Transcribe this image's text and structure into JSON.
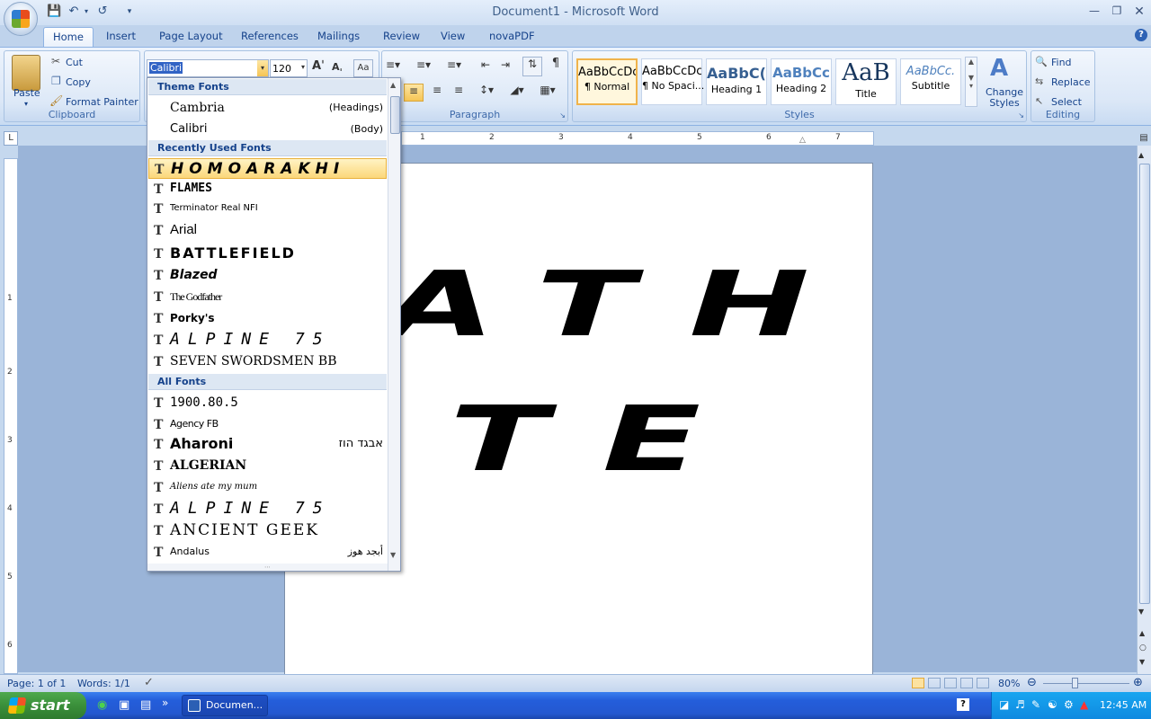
{
  "window": {
    "title": "Document1 - Microsoft Word"
  },
  "tabs": [
    "Home",
    "Insert",
    "Page Layout",
    "References",
    "Mailings",
    "Review",
    "View",
    "novaPDF"
  ],
  "clipboard": {
    "paste": "Paste",
    "cut": "Cut",
    "copy": "Copy",
    "format_painter": "Format Painter",
    "label": "Clipboard"
  },
  "font": {
    "name": "Calibri",
    "size": "120"
  },
  "paragraph": {
    "label": "Paragraph"
  },
  "styles": {
    "label": "Styles",
    "items": [
      {
        "sample": "AaBbCcDc",
        "name": "¶ Normal"
      },
      {
        "sample": "AaBbCcDc",
        "name": "¶ No Spaci..."
      },
      {
        "sample": "AaBbC(",
        "name": "Heading 1"
      },
      {
        "sample": "AaBbCc",
        "name": "Heading 2"
      },
      {
        "sample": "AaB",
        "name": "Title"
      },
      {
        "sample": "AaBbCc.",
        "name": "Subtitle"
      }
    ],
    "change": "Change Styles"
  },
  "editing": {
    "find": "Find",
    "replace": "Replace",
    "select": "Select",
    "label": "Editing"
  },
  "ruler": {
    "numbers": [
      "1",
      "2",
      "3",
      "4",
      "5",
      "6",
      "7"
    ]
  },
  "vruler": {
    "numbers": [
      "1",
      "2",
      "3",
      "4",
      "5",
      "6"
    ]
  },
  "document": {
    "line1": "ATH",
    "line2": "LETE"
  },
  "font_dropdown": {
    "theme_header": "Theme Fonts",
    "theme": [
      {
        "name": "Cambria",
        "tag": "(Headings)"
      },
      {
        "name": "Calibri",
        "tag": "(Body)"
      }
    ],
    "recent_header": "Recently Used Fonts",
    "recent": [
      "HOMOARAKHI",
      "FLAMES",
      "Terminator Real NFI",
      "Arial",
      "BATTLEFIELD",
      "Blazed",
      "The Godfather",
      "Porky's",
      "ALPINE 75",
      "SEVEN SWORDSMEN BB"
    ],
    "all_header": "All Fonts",
    "all": [
      {
        "name": "1900.80.5",
        "tag": ""
      },
      {
        "name": "Agency FB",
        "tag": ""
      },
      {
        "name": "Aharoni",
        "tag": "אבגד הוז"
      },
      {
        "name": "ALGERIAN",
        "tag": ""
      },
      {
        "name": "Aliens ate my mum",
        "tag": ""
      },
      {
        "name": "ALPINE 75",
        "tag": ""
      },
      {
        "name": "ANCIENT GEEK",
        "tag": ""
      },
      {
        "name": "Andalus",
        "tag": "أبجد هوز"
      }
    ]
  },
  "status": {
    "page": "Page: 1 of 1",
    "words": "Words: 1/1",
    "zoom": "80%"
  },
  "taskbar": {
    "start": "start",
    "task": "Documen...",
    "time": "12:45 AM"
  }
}
